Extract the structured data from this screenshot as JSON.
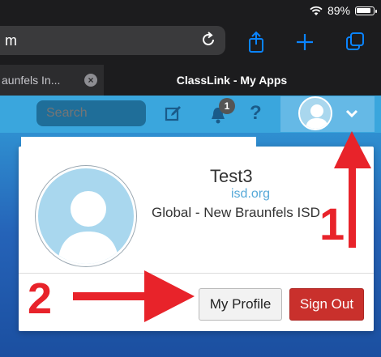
{
  "status_bar": {
    "battery": "89%",
    "battery_level": 0.89
  },
  "safari": {
    "url_fragment": "m",
    "tabs": [
      {
        "label": "aunfels In..."
      },
      {
        "label": "ClassLink - My Apps"
      }
    ]
  },
  "header": {
    "search_placeholder": "Search",
    "notification_count": "1",
    "help_label": "?"
  },
  "profile_menu": {
    "name": "Test3",
    "domain": "isd.org",
    "organization": "Global - New Braunfels ISD",
    "my_profile_label": "My Profile",
    "sign_out_label": "Sign Out"
  },
  "annotations": {
    "step_1": "1",
    "step_2": "2"
  },
  "colors": {
    "header_blue": "#3aa6dd",
    "sign_out_red": "#c9302c",
    "annotation_red": "#e8232a"
  }
}
